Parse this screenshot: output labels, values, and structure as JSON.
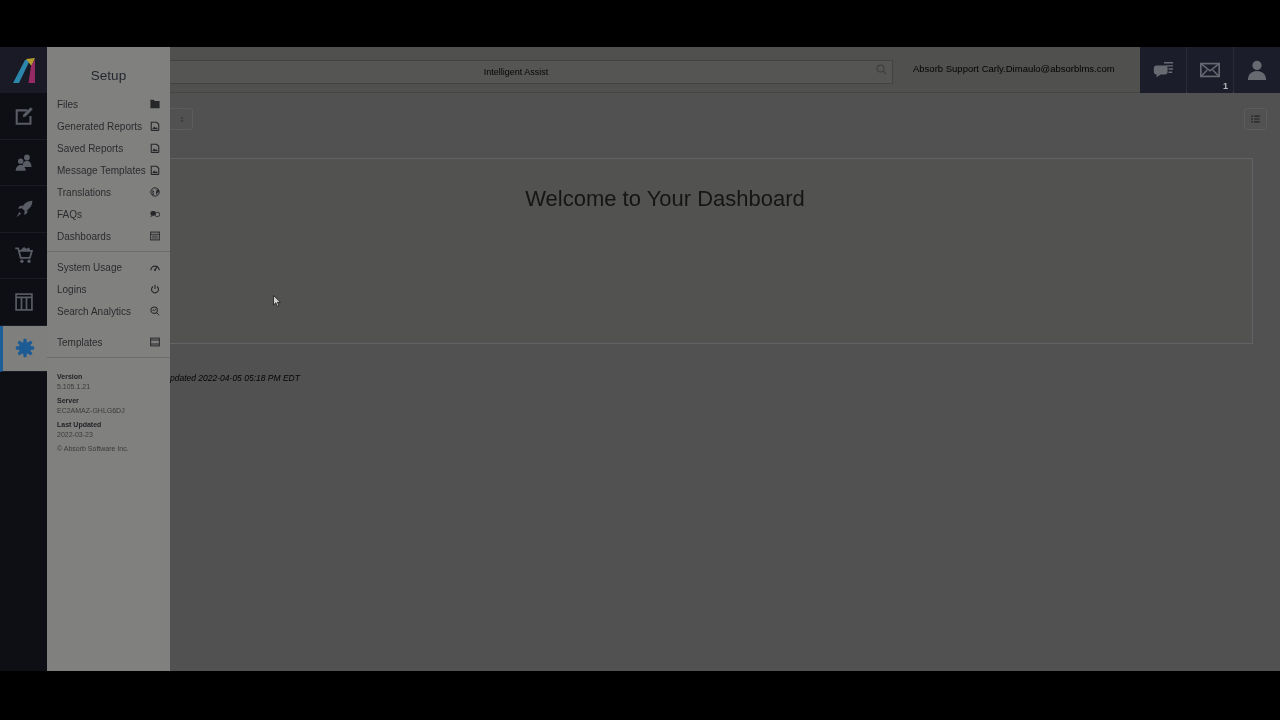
{
  "nav_rail": {
    "items": [
      {
        "kind": "edit",
        "selected": false
      },
      {
        "kind": "users",
        "selected": false
      },
      {
        "kind": "rocket",
        "selected": false
      },
      {
        "kind": "cart",
        "selected": false
      },
      {
        "kind": "columns",
        "selected": false
      },
      {
        "kind": "settings",
        "selected": true
      }
    ]
  },
  "setup_menu": {
    "title": "Setup",
    "sections": [
      {
        "divider_below": true,
        "items": [
          {
            "label": "Files",
            "kind": "folder"
          },
          {
            "label": "Generated Reports",
            "kind": "report"
          },
          {
            "label": "Saved Reports",
            "kind": "report"
          },
          {
            "label": "Message Templates",
            "kind": "report"
          },
          {
            "label": "Translations",
            "kind": "globe"
          },
          {
            "label": "FAQs",
            "kind": "faq"
          },
          {
            "label": "Dashboards",
            "kind": "dashboard"
          }
        ]
      },
      {
        "divider_below": false,
        "items": [
          {
            "label": "System Usage",
            "kind": "gauge"
          },
          {
            "label": "Logins",
            "kind": "power"
          },
          {
            "label": "Search Analytics",
            "kind": "search"
          }
        ]
      },
      {
        "divider_below": true,
        "items": [
          {
            "label": "Templates",
            "kind": "template"
          }
        ]
      }
    ],
    "info": [
      {
        "label": "Version",
        "value": "5.105.1.21"
      },
      {
        "label": "Server",
        "value": "EC2AMAZ-GHLG6DJ"
      },
      {
        "label": "Last Updated",
        "value": "2022-03-23"
      }
    ],
    "copyright": "© Absorb Software Inc."
  },
  "header": {
    "search": {
      "placeholder": "Intelligent Assist"
    },
    "user_label": "Absorb Support Carly.Dimaulo@absorblms.com",
    "buttons": [
      {
        "kind": "help"
      },
      {
        "kind": "mail",
        "badge": "1"
      },
      {
        "kind": "user"
      }
    ]
  },
  "dashboard": {
    "title": "Welcome to Your Dashboard",
    "updated_note": "pdated 2022-04-05 05:18 PM EDT"
  }
}
